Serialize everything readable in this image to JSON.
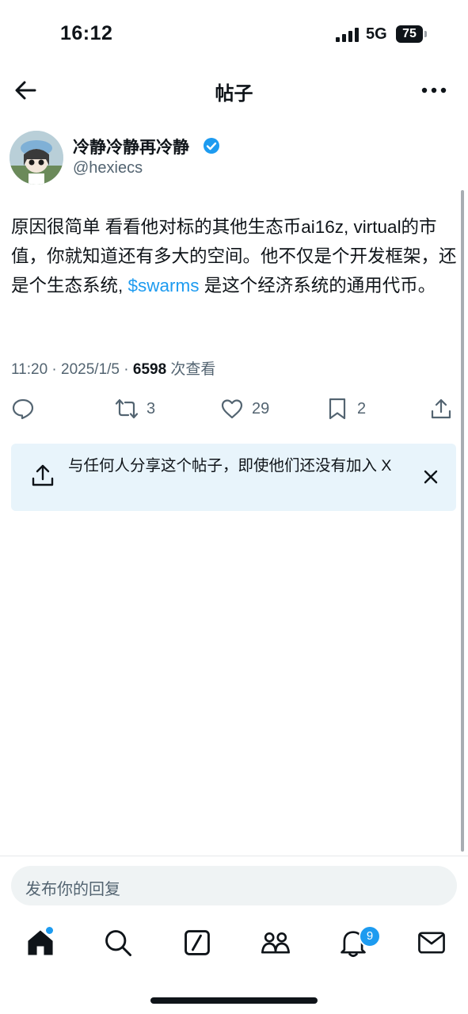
{
  "status_bar": {
    "time": "16:12",
    "network": "5G",
    "battery": "75"
  },
  "header": {
    "title": "帖子"
  },
  "post": {
    "author_name": "冷静冷静再冷静",
    "author_handle": "@hexiecs",
    "text_before": "原因很简单 看看他对标的其他生态币ai16z, virtual的市值，你就知道还有多大的空间。他不仅是个开发框架，还是个生态系统, ",
    "cashtag": "$swarms",
    "text_after": " 是这个经济系统的通用代币。",
    "timestamp": "11:20 · 2025/1/5 · ",
    "views": "6598",
    "views_label": " 次查看",
    "retweets": "3",
    "likes": "29",
    "bookmarks": "2"
  },
  "share_banner": {
    "text": "与任何人分享这个帖子，即使他们还没有加入 X"
  },
  "reply": {
    "placeholder": "发布你的回复"
  },
  "tab_bar": {
    "notification_count": "9"
  },
  "colors": {
    "accent": "#1d9bf0",
    "text": "#0f1419",
    "secondary": "#536471"
  }
}
